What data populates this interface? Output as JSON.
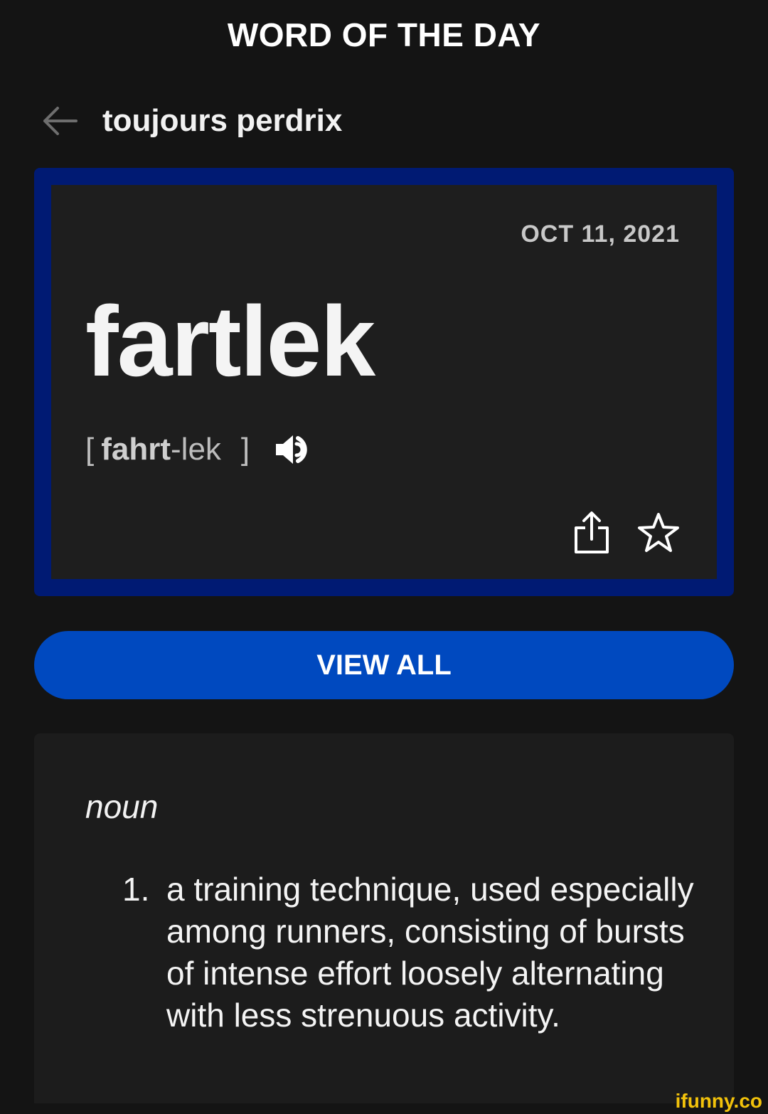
{
  "header": {
    "title": "WORD OF THE DAY"
  },
  "nav": {
    "title": "toujours perdrix",
    "back_icon": "arrow-left-icon"
  },
  "word_card": {
    "date": "OCT 11, 2021",
    "word": "fartlek",
    "pronunciation": {
      "open": "[",
      "stressed": "fahrt",
      "rest": "-lek",
      "close": "]"
    },
    "icons": [
      "speaker-icon",
      "share-icon",
      "star-icon"
    ],
    "border_color": "#001a73"
  },
  "view_all": {
    "label": "VIEW ALL",
    "color": "#0049bf"
  },
  "definition": {
    "part_of_speech": "noun",
    "items": [
      {
        "number": "1.",
        "text": "a training technique, used especially among runners, consisting of bursts of intense effort loosely alternating with less strenuous activity."
      }
    ]
  },
  "watermark": {
    "text": "ifunny.co",
    "color": "#f2c20b"
  }
}
